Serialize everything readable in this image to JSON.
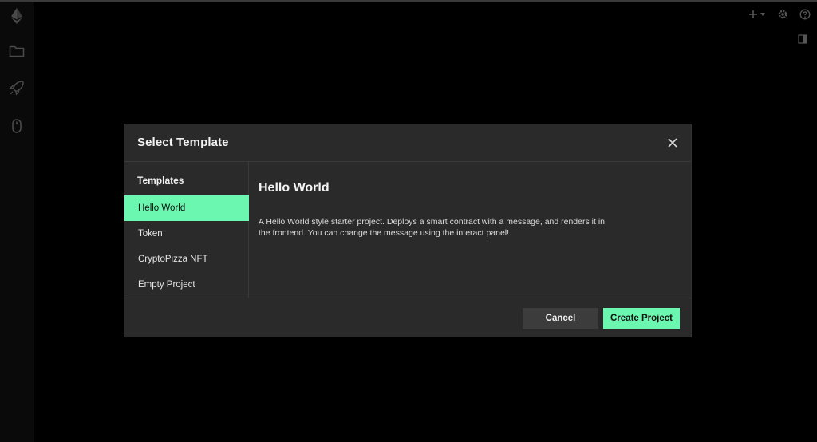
{
  "icons": {
    "logo": "ethereum-icon",
    "files": "folder-icon",
    "deploy": "rocket-icon",
    "interact": "mouse-icon",
    "add": "plus-icon",
    "settings": "gear-icon",
    "help": "question-icon",
    "panel": "panel-toggle-icon",
    "close": "close-icon"
  },
  "colors": {
    "accent": "#6cf7b0",
    "background": "#000000",
    "modal": "#2a2a2a"
  },
  "modal": {
    "title": "Select Template",
    "templates_heading": "Templates",
    "templates": [
      {
        "label": "Hello World",
        "selected": true
      },
      {
        "label": "Token",
        "selected": false
      },
      {
        "label": "CryptoPizza NFT",
        "selected": false
      },
      {
        "label": "Empty Project",
        "selected": false
      }
    ],
    "detail": {
      "title": "Hello World",
      "description": "A Hello World style starter project. Deploys a smart contract with a message, and renders it in the frontend. You can change the message using the interact panel!"
    },
    "buttons": {
      "cancel": "Cancel",
      "create": "Create Project"
    }
  }
}
